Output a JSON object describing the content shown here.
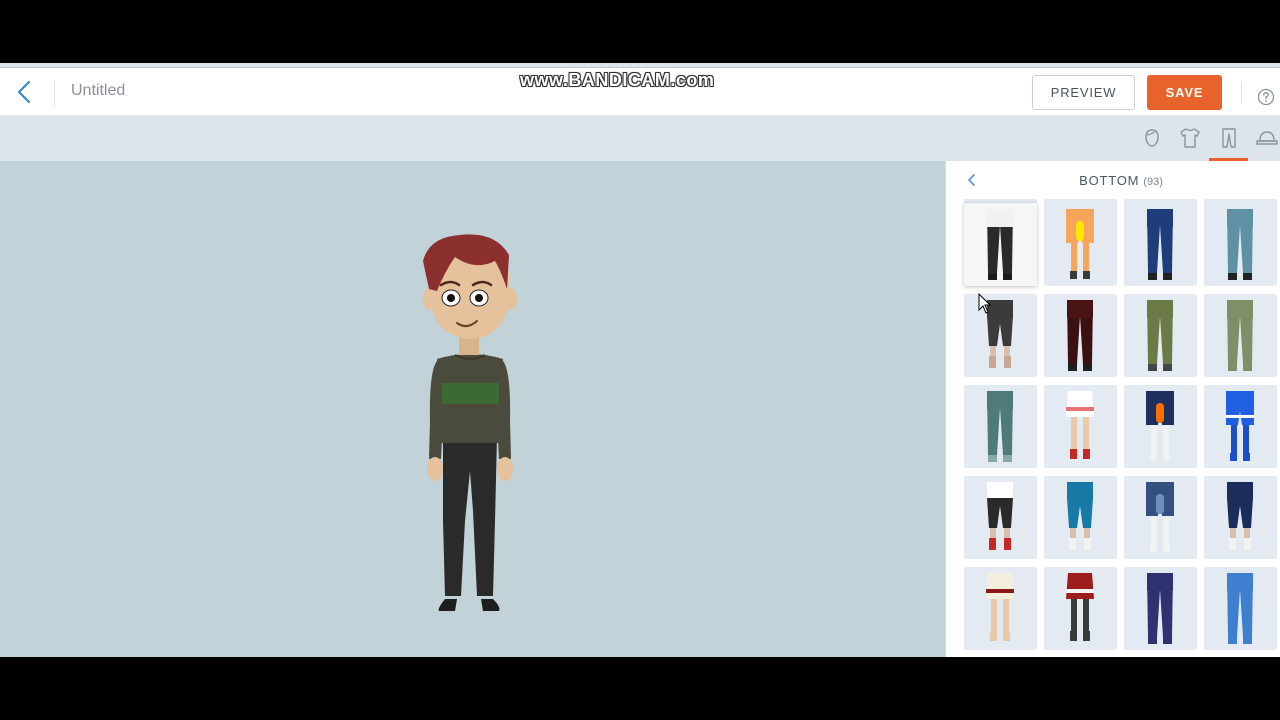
{
  "header": {
    "back_icon": "chevron-left-icon",
    "document_title": "Untitled",
    "watermark": "www.BANDICAM.com",
    "preview_label": "PREVIEW",
    "save_label": "SAVE",
    "help_icon": "question-circle-icon",
    "colors": {
      "save": "#e8632c",
      "accent": "#e8632c"
    }
  },
  "toolbar": {
    "icons": [
      "head-icon",
      "shirt-icon",
      "pants-icon",
      "hat-icon"
    ],
    "active": "pants-icon"
  },
  "panel": {
    "title": "BOTTOM",
    "count": "(93)",
    "back_icon": "chevron-left-icon"
  },
  "bottoms": [
    {
      "kind": "partial",
      "top": "#303438",
      "legs": "#303438",
      "feet": "#303438",
      "skin": false
    },
    {
      "kind": "partial",
      "top": "#e6c29c",
      "legs": "#e6c29c",
      "feet": "#e6c29c",
      "skin": true
    },
    {
      "kind": "partial",
      "top": "#2b4a72",
      "legs": "#2b4a72",
      "feet": "#e6c29c",
      "skin": false
    },
    {
      "kind": "partial",
      "top": "#e6c29c",
      "legs": "#e6c29c",
      "feet": "#e6c29c",
      "skin": true
    },
    {
      "kind": "pants",
      "top": "#f1f1f1",
      "legs": "#2a2a2a",
      "feet": "#1e1e1e",
      "stripe": "",
      "selected": true
    },
    {
      "kind": "shorts",
      "top": "#f7a55a",
      "legs": "#f7a55a",
      "feet": "#3a3a3a",
      "stripe": "#ffe600"
    },
    {
      "kind": "pants",
      "top": "#1e3d7a",
      "legs": "#1e3d7a",
      "feet": "#222",
      "stripe": ""
    },
    {
      "kind": "pants",
      "top": "#5e91a3",
      "legs": "#5e91a3",
      "feet": "#222",
      "stripe": ""
    },
    {
      "kind": "capri",
      "top": "#3b3b3b",
      "legs": "#3b3b3b",
      "feet": "#c9a893",
      "stripe": ""
    },
    {
      "kind": "pants",
      "top": "#4a1414",
      "legs": "#3a1010",
      "feet": "#1e1e1e",
      "stripe": ""
    },
    {
      "kind": "pants",
      "top": "#6b7a47",
      "legs": "#6b7a47",
      "feet": "#444",
      "stripe": ""
    },
    {
      "kind": "pants",
      "top": "#7f8f68",
      "legs": "#7f8f68",
      "feet": "#7f8f68",
      "stripe": ""
    },
    {
      "kind": "pants",
      "top": "#4e7a7a",
      "legs": "#4e7a7a",
      "feet": "#8aa",
      "stripe": ""
    },
    {
      "kind": "skirt",
      "top": "#ffffff",
      "legs": "#e8c9a9",
      "feet": "#c62828",
      "stripe": "#e57373"
    },
    {
      "kind": "shorts",
      "top": "#1d2f5c",
      "legs": "#f2f2f2",
      "feet": "#f2f2f2",
      "stripe": "#ff6f00"
    },
    {
      "kind": "shorts",
      "top": "#1f5fe0",
      "legs": "#1a4fc9",
      "feet": "#1a4fc9",
      "stripe": ""
    },
    {
      "kind": "capri",
      "top": "#ffffff",
      "legs": "#2a2a2a",
      "feet": "#c62828",
      "stripe": ""
    },
    {
      "kind": "capri",
      "top": "#1679a6",
      "legs": "#1679a6",
      "feet": "#f2f2f2",
      "stripe": ""
    },
    {
      "kind": "shorts",
      "top": "#33507e",
      "legs": "#f2f2f2",
      "feet": "#f2f2f2",
      "stripe": "#6d8fbf"
    },
    {
      "kind": "capri",
      "top": "#1b2d5a",
      "legs": "#1b2d5a",
      "feet": "#f2f2f2",
      "stripe": ""
    },
    {
      "kind": "skirt",
      "top": "#f4efdc",
      "legs": "#e8c9a9",
      "feet": "#e8c9a9",
      "stripe": "#8b1a1a"
    },
    {
      "kind": "skirt",
      "top": "#9d1c1c",
      "legs": "#3a3a3a",
      "feet": "#3a3a3a",
      "stripe": "#f2f2f2"
    },
    {
      "kind": "pants",
      "top": "#2f3170",
      "legs": "#2f3170",
      "feet": "#2f3170",
      "stripe": ""
    },
    {
      "kind": "pants",
      "top": "#3e7fcf",
      "legs": "#3e7fcf",
      "feet": "#3e7fcf",
      "stripe": ""
    }
  ],
  "character": {
    "hair": "#8b2f2f",
    "skin": "#e6c29c",
    "sweater": "#4a4b3d",
    "stripe": "#3d6a32",
    "pants": "#2a2a2a",
    "shoes": "#1e1e1e"
  }
}
